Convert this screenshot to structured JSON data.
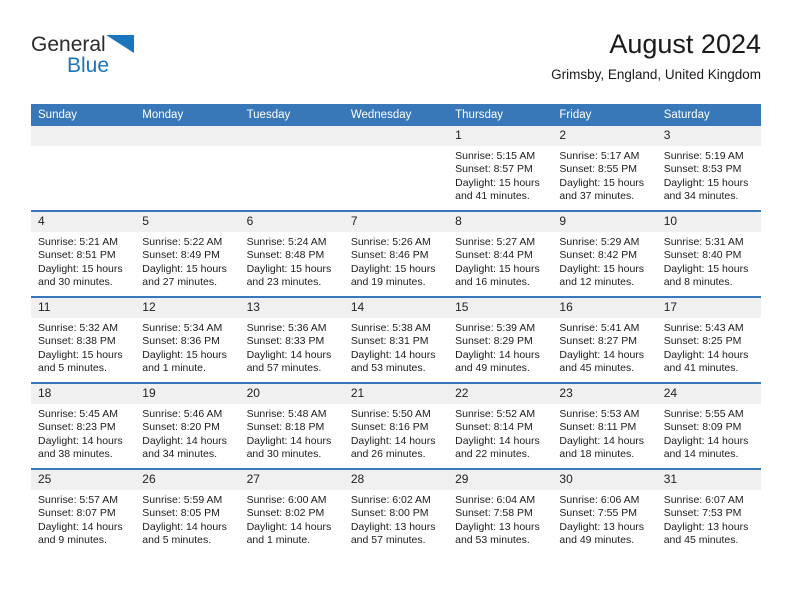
{
  "brand": {
    "name_part1": "General",
    "name_part2": "Blue",
    "logo_icon": "blue-triangle-icon",
    "accent_color": "#1b75bb"
  },
  "header": {
    "month_title": "August 2024",
    "location": "Grimsby, England, United Kingdom"
  },
  "calendar": {
    "header_bg": "#3878b8",
    "weekday_headers": [
      "Sunday",
      "Monday",
      "Tuesday",
      "Wednesday",
      "Thursday",
      "Friday",
      "Saturday"
    ],
    "weeks": [
      [
        {
          "day": "",
          "empty": true
        },
        {
          "day": "",
          "empty": true
        },
        {
          "day": "",
          "empty": true
        },
        {
          "day": "",
          "empty": true
        },
        {
          "day": "1",
          "sunrise": "Sunrise: 5:15 AM",
          "sunset": "Sunset: 8:57 PM",
          "daylight1": "Daylight: 15 hours",
          "daylight2": "and 41 minutes."
        },
        {
          "day": "2",
          "sunrise": "Sunrise: 5:17 AM",
          "sunset": "Sunset: 8:55 PM",
          "daylight1": "Daylight: 15 hours",
          "daylight2": "and 37 minutes."
        },
        {
          "day": "3",
          "sunrise": "Sunrise: 5:19 AM",
          "sunset": "Sunset: 8:53 PM",
          "daylight1": "Daylight: 15 hours",
          "daylight2": "and 34 minutes."
        }
      ],
      [
        {
          "day": "4",
          "sunrise": "Sunrise: 5:21 AM",
          "sunset": "Sunset: 8:51 PM",
          "daylight1": "Daylight: 15 hours",
          "daylight2": "and 30 minutes."
        },
        {
          "day": "5",
          "sunrise": "Sunrise: 5:22 AM",
          "sunset": "Sunset: 8:49 PM",
          "daylight1": "Daylight: 15 hours",
          "daylight2": "and 27 minutes."
        },
        {
          "day": "6",
          "sunrise": "Sunrise: 5:24 AM",
          "sunset": "Sunset: 8:48 PM",
          "daylight1": "Daylight: 15 hours",
          "daylight2": "and 23 minutes."
        },
        {
          "day": "7",
          "sunrise": "Sunrise: 5:26 AM",
          "sunset": "Sunset: 8:46 PM",
          "daylight1": "Daylight: 15 hours",
          "daylight2": "and 19 minutes."
        },
        {
          "day": "8",
          "sunrise": "Sunrise: 5:27 AM",
          "sunset": "Sunset: 8:44 PM",
          "daylight1": "Daylight: 15 hours",
          "daylight2": "and 16 minutes."
        },
        {
          "day": "9",
          "sunrise": "Sunrise: 5:29 AM",
          "sunset": "Sunset: 8:42 PM",
          "daylight1": "Daylight: 15 hours",
          "daylight2": "and 12 minutes."
        },
        {
          "day": "10",
          "sunrise": "Sunrise: 5:31 AM",
          "sunset": "Sunset: 8:40 PM",
          "daylight1": "Daylight: 15 hours",
          "daylight2": "and 8 minutes."
        }
      ],
      [
        {
          "day": "11",
          "sunrise": "Sunrise: 5:32 AM",
          "sunset": "Sunset: 8:38 PM",
          "daylight1": "Daylight: 15 hours",
          "daylight2": "and 5 minutes."
        },
        {
          "day": "12",
          "sunrise": "Sunrise: 5:34 AM",
          "sunset": "Sunset: 8:36 PM",
          "daylight1": "Daylight: 15 hours",
          "daylight2": "and 1 minute."
        },
        {
          "day": "13",
          "sunrise": "Sunrise: 5:36 AM",
          "sunset": "Sunset: 8:33 PM",
          "daylight1": "Daylight: 14 hours",
          "daylight2": "and 57 minutes."
        },
        {
          "day": "14",
          "sunrise": "Sunrise: 5:38 AM",
          "sunset": "Sunset: 8:31 PM",
          "daylight1": "Daylight: 14 hours",
          "daylight2": "and 53 minutes."
        },
        {
          "day": "15",
          "sunrise": "Sunrise: 5:39 AM",
          "sunset": "Sunset: 8:29 PM",
          "daylight1": "Daylight: 14 hours",
          "daylight2": "and 49 minutes."
        },
        {
          "day": "16",
          "sunrise": "Sunrise: 5:41 AM",
          "sunset": "Sunset: 8:27 PM",
          "daylight1": "Daylight: 14 hours",
          "daylight2": "and 45 minutes."
        },
        {
          "day": "17",
          "sunrise": "Sunrise: 5:43 AM",
          "sunset": "Sunset: 8:25 PM",
          "daylight1": "Daylight: 14 hours",
          "daylight2": "and 41 minutes."
        }
      ],
      [
        {
          "day": "18",
          "sunrise": "Sunrise: 5:45 AM",
          "sunset": "Sunset: 8:23 PM",
          "daylight1": "Daylight: 14 hours",
          "daylight2": "and 38 minutes."
        },
        {
          "day": "19",
          "sunrise": "Sunrise: 5:46 AM",
          "sunset": "Sunset: 8:20 PM",
          "daylight1": "Daylight: 14 hours",
          "daylight2": "and 34 minutes."
        },
        {
          "day": "20",
          "sunrise": "Sunrise: 5:48 AM",
          "sunset": "Sunset: 8:18 PM",
          "daylight1": "Daylight: 14 hours",
          "daylight2": "and 30 minutes."
        },
        {
          "day": "21",
          "sunrise": "Sunrise: 5:50 AM",
          "sunset": "Sunset: 8:16 PM",
          "daylight1": "Daylight: 14 hours",
          "daylight2": "and 26 minutes."
        },
        {
          "day": "22",
          "sunrise": "Sunrise: 5:52 AM",
          "sunset": "Sunset: 8:14 PM",
          "daylight1": "Daylight: 14 hours",
          "daylight2": "and 22 minutes."
        },
        {
          "day": "23",
          "sunrise": "Sunrise: 5:53 AM",
          "sunset": "Sunset: 8:11 PM",
          "daylight1": "Daylight: 14 hours",
          "daylight2": "and 18 minutes."
        },
        {
          "day": "24",
          "sunrise": "Sunrise: 5:55 AM",
          "sunset": "Sunset: 8:09 PM",
          "daylight1": "Daylight: 14 hours",
          "daylight2": "and 14 minutes."
        }
      ],
      [
        {
          "day": "25",
          "sunrise": "Sunrise: 5:57 AM",
          "sunset": "Sunset: 8:07 PM",
          "daylight1": "Daylight: 14 hours",
          "daylight2": "and 9 minutes."
        },
        {
          "day": "26",
          "sunrise": "Sunrise: 5:59 AM",
          "sunset": "Sunset: 8:05 PM",
          "daylight1": "Daylight: 14 hours",
          "daylight2": "and 5 minutes."
        },
        {
          "day": "27",
          "sunrise": "Sunrise: 6:00 AM",
          "sunset": "Sunset: 8:02 PM",
          "daylight1": "Daylight: 14 hours",
          "daylight2": "and 1 minute."
        },
        {
          "day": "28",
          "sunrise": "Sunrise: 6:02 AM",
          "sunset": "Sunset: 8:00 PM",
          "daylight1": "Daylight: 13 hours",
          "daylight2": "and 57 minutes."
        },
        {
          "day": "29",
          "sunrise": "Sunrise: 6:04 AM",
          "sunset": "Sunset: 7:58 PM",
          "daylight1": "Daylight: 13 hours",
          "daylight2": "and 53 minutes."
        },
        {
          "day": "30",
          "sunrise": "Sunrise: 6:06 AM",
          "sunset": "Sunset: 7:55 PM",
          "daylight1": "Daylight: 13 hours",
          "daylight2": "and 49 minutes."
        },
        {
          "day": "31",
          "sunrise": "Sunrise: 6:07 AM",
          "sunset": "Sunset: 7:53 PM",
          "daylight1": "Daylight: 13 hours",
          "daylight2": "and 45 minutes."
        }
      ]
    ]
  }
}
